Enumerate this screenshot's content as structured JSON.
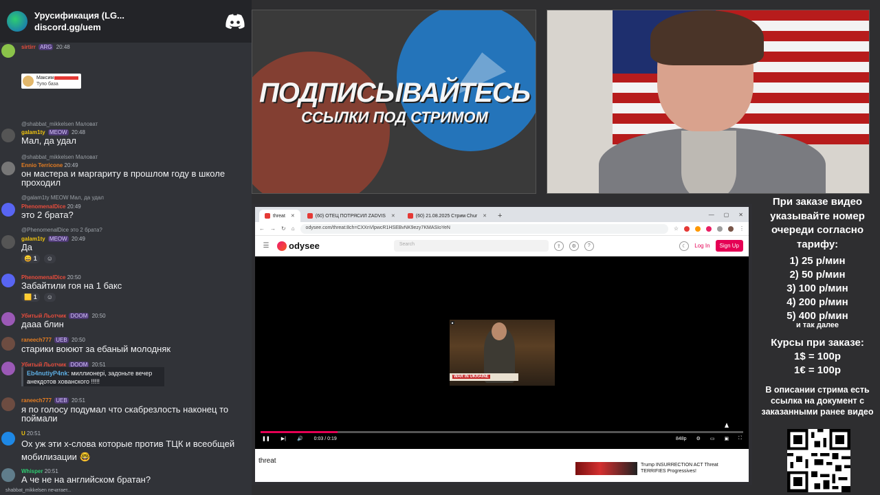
{
  "chat": {
    "server_name": "Урусификация (LG...",
    "server_link": "discord.gg/uem",
    "embed": {
      "name": "Максим",
      "text": "Тупо база"
    },
    "messages": [
      {
        "nick": "sirtirr",
        "badge": "ARG",
        "time": "20:48",
        "reply": "",
        "text": "",
        "nick_color": "#e74c3c",
        "avatar_color": "#8bc34a"
      },
      {
        "nick": "galam1ty",
        "badge": "MEOW",
        "time": "20:48",
        "reply": "@shabbat_mikkelsen Маловат",
        "text": "Мал, да удал",
        "nick_color": "#f1c40f",
        "avatar_color": "#555"
      },
      {
        "nick": "Ennio Terricone",
        "badge": "",
        "time": "20:49",
        "reply": "@shabbat_mikkelsen Маловат",
        "text": "он мастера и маргариту в прошлом году в школе проходил",
        "nick_color": "#e67e22",
        "avatar_color": "#777"
      },
      {
        "nick": "PhenomenalDice",
        "badge": "",
        "time": "20:49",
        "reply": "@galam1ty MEOW Мал, да удал",
        "text": "это 2 брата?",
        "nick_color": "#e74c3c",
        "avatar_color": "#5865f2"
      },
      {
        "nick": "galam1ty",
        "badge": "MEOW",
        "time": "20:49",
        "reply": "@PhenomenalDice это 2 брата?",
        "text": "Да",
        "nick_color": "#f1c40f",
        "avatar_color": "#555"
      },
      {
        "nick": "PhenomenalDice",
        "badge": "",
        "time": "20:50",
        "reply": "",
        "text": "Забайтили гоя на 1 бакс",
        "nick_color": "#e74c3c",
        "avatar_color": "#5865f2"
      },
      {
        "nick": "Убитый Льотчик",
        "badge": "DOOM",
        "time": "20:50",
        "reply": "",
        "text": "дааа блин",
        "nick_color": "#e74c3c",
        "avatar_color": "#9b59b6"
      },
      {
        "nick": "raneech777",
        "badge": "UEB",
        "time": "20:50",
        "reply": "",
        "text": "старики воюют за ебаный молодняк",
        "nick_color": "#e67e22",
        "avatar_color": "#6d4c41"
      },
      {
        "nick": "Убитый Льотчик",
        "badge": "DOOM",
        "time": "20:51",
        "reply": "",
        "text": "",
        "nick_color": "#e74c3c",
        "avatar_color": "#9b59b6"
      },
      {
        "nick": "raneech777",
        "badge": "UEB",
        "time": "20:51",
        "reply": "",
        "text": "я по голосу подумал что скабрезлость наконец то поймали",
        "nick_color": "#e67e22",
        "avatar_color": "#6d4c41"
      },
      {
        "nick": "U",
        "badge": "",
        "time": "20:51",
        "reply": "",
        "text": "Ох уж эти х-слова которые против ТЦК и всеобщей мобилизации 🤓",
        "nick_color": "#f1c40f",
        "avatar_color": "#1e88e5"
      },
      {
        "nick": "Whisper",
        "badge": "",
        "time": "20:51",
        "reply": "",
        "text": "А че не на английском братан?",
        "nick_color": "#2ecc71",
        "avatar_color": "#607d8b"
      }
    ],
    "quote": {
      "name": "Eb4nutiyP4nk",
      "text": ": миллионері, задоньте вечер анекдотов хованского !!!!!"
    },
    "reactions": [
      {
        "emoji": "😄",
        "count": "1"
      },
      {
        "emoji": "🟨",
        "count": "1"
      }
    ],
    "typing": "shabbat_mikkelsen печатает..."
  },
  "banner": {
    "title": "ПОДПИСЫВАЙТЕСЬ",
    "subtitle": "ССЫЛКИ ПОД СТРИМОМ"
  },
  "browser": {
    "tabs": [
      {
        "label": "threat",
        "active": true
      },
      {
        "label": "(60) ОТЕЦ ПОТРЯСИЛ ZADVIS",
        "active": false
      },
      {
        "label": "(60) 21.08.2025 Стрим Chur",
        "active": false
      }
    ],
    "url": "odysee.com/threat:8ch=CXXnVlpwcR1HSEBvNK9ezy7KMASIoYeN",
    "search_placeholder": "Search",
    "site_name": "odysee",
    "login": "Log In",
    "signup": "Sign Up",
    "time_current": "0:03",
    "time_sep": "/",
    "time_total": "0:19",
    "quality": "848p",
    "progress": 0.16,
    "video_title": "threat",
    "lower_third_tag": "WAR IN UKRAINE",
    "suggestion": "Trump INSURRECTION ACT Threat TERRIFIES Progressives!"
  },
  "prices": {
    "heading": "При заказе видео указывайте номер очереди согласно тарифу:",
    "tiers": [
      "1) 25 р/мин",
      "2) 50 р/мин",
      "3) 100 р/мин",
      "4) 200 р/мин",
      "5) 400 р/мин"
    ],
    "more": "и так далее",
    "rates_heading": "Курсы при заказе:",
    "rates": [
      "1$ = 100р",
      "1€ = 100р"
    ],
    "desc": "В описании стрима есть ссылка на документ с заказанными ранее видео"
  }
}
